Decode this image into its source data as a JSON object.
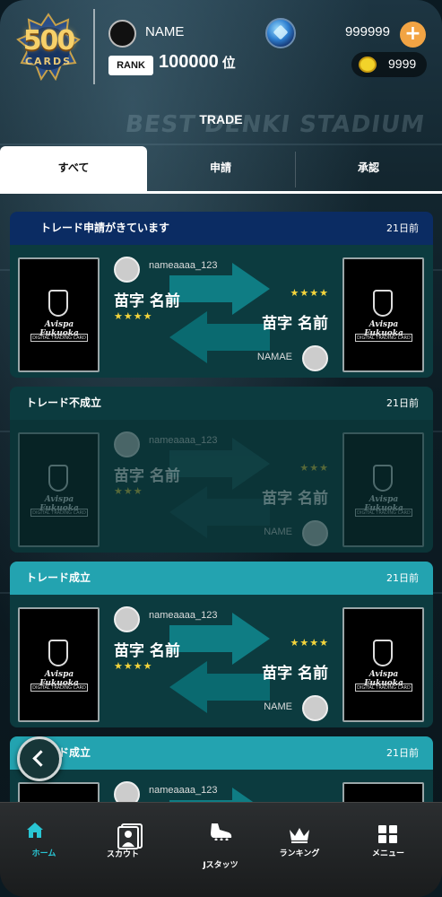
{
  "header": {
    "logo": {
      "number": "500",
      "word": "CARDS"
    },
    "user_name": "NAME",
    "rank_label": "RANK",
    "rank_value": "100000",
    "rank_suffix": "位",
    "gem_count": "999999",
    "coin_count": "9999",
    "background_sign": "BEST DENKI STADIUM"
  },
  "page_title": "TRADE",
  "tabs": [
    {
      "label": "すべて",
      "active": true
    },
    {
      "label": "申請",
      "active": false
    },
    {
      "label": "承認",
      "active": false
    }
  ],
  "trades": [
    {
      "status": "トレード申請がきています",
      "date": "21日前",
      "variant": "pending",
      "user_top": "nameaaaa_123",
      "name_left": "苗字 名前",
      "stars_left": "★★★★",
      "stars_right": "★★★★",
      "name_right": "苗字 名前",
      "user_bottom": "NAMAE"
    },
    {
      "status": "トレード不成立",
      "date": "21日前",
      "variant": "failed",
      "user_top": "nameaaaa_123",
      "name_left": "苗字 名前",
      "stars_left": "★★★",
      "stars_right": "★★★",
      "name_right": "苗字 名前",
      "user_bottom": "NAME"
    },
    {
      "status": "トレード成立",
      "date": "21日前",
      "variant": "success",
      "user_top": "nameaaaa_123",
      "name_left": "苗字 名前",
      "stars_left": "★★★★",
      "stars_right": "★★★★",
      "name_right": "苗字 名前",
      "user_bottom": "NAME"
    },
    {
      "status": "トレード成立",
      "date": "21日前",
      "variant": "success",
      "user_top": "nameaaaa_123",
      "name_left": "",
      "stars_left": "",
      "stars_right": "",
      "name_right": "",
      "user_bottom": ""
    }
  ],
  "card_brand": {
    "script": "Avispa Fukuoka",
    "line": "DIGITAL TRADING CARD"
  },
  "bottom_nav": [
    {
      "label": "ホーム",
      "icon": "home-icon",
      "active": true
    },
    {
      "label": "スカウト",
      "icon": "scout-card-icon",
      "active": false
    },
    {
      "label": "Jスタッツ",
      "icon": "boot-icon",
      "active": false
    },
    {
      "label": "ランキング",
      "icon": "crown-icon",
      "active": false
    },
    {
      "label": "メニュー",
      "icon": "menu-grid-icon",
      "active": false
    }
  ],
  "colors": {
    "pending_header": "#0b2c63",
    "failed_header": "#0c3b3f",
    "success_header": "#23a3b0",
    "active_nav": "#29c5d3",
    "star": "#f4d53c"
  }
}
